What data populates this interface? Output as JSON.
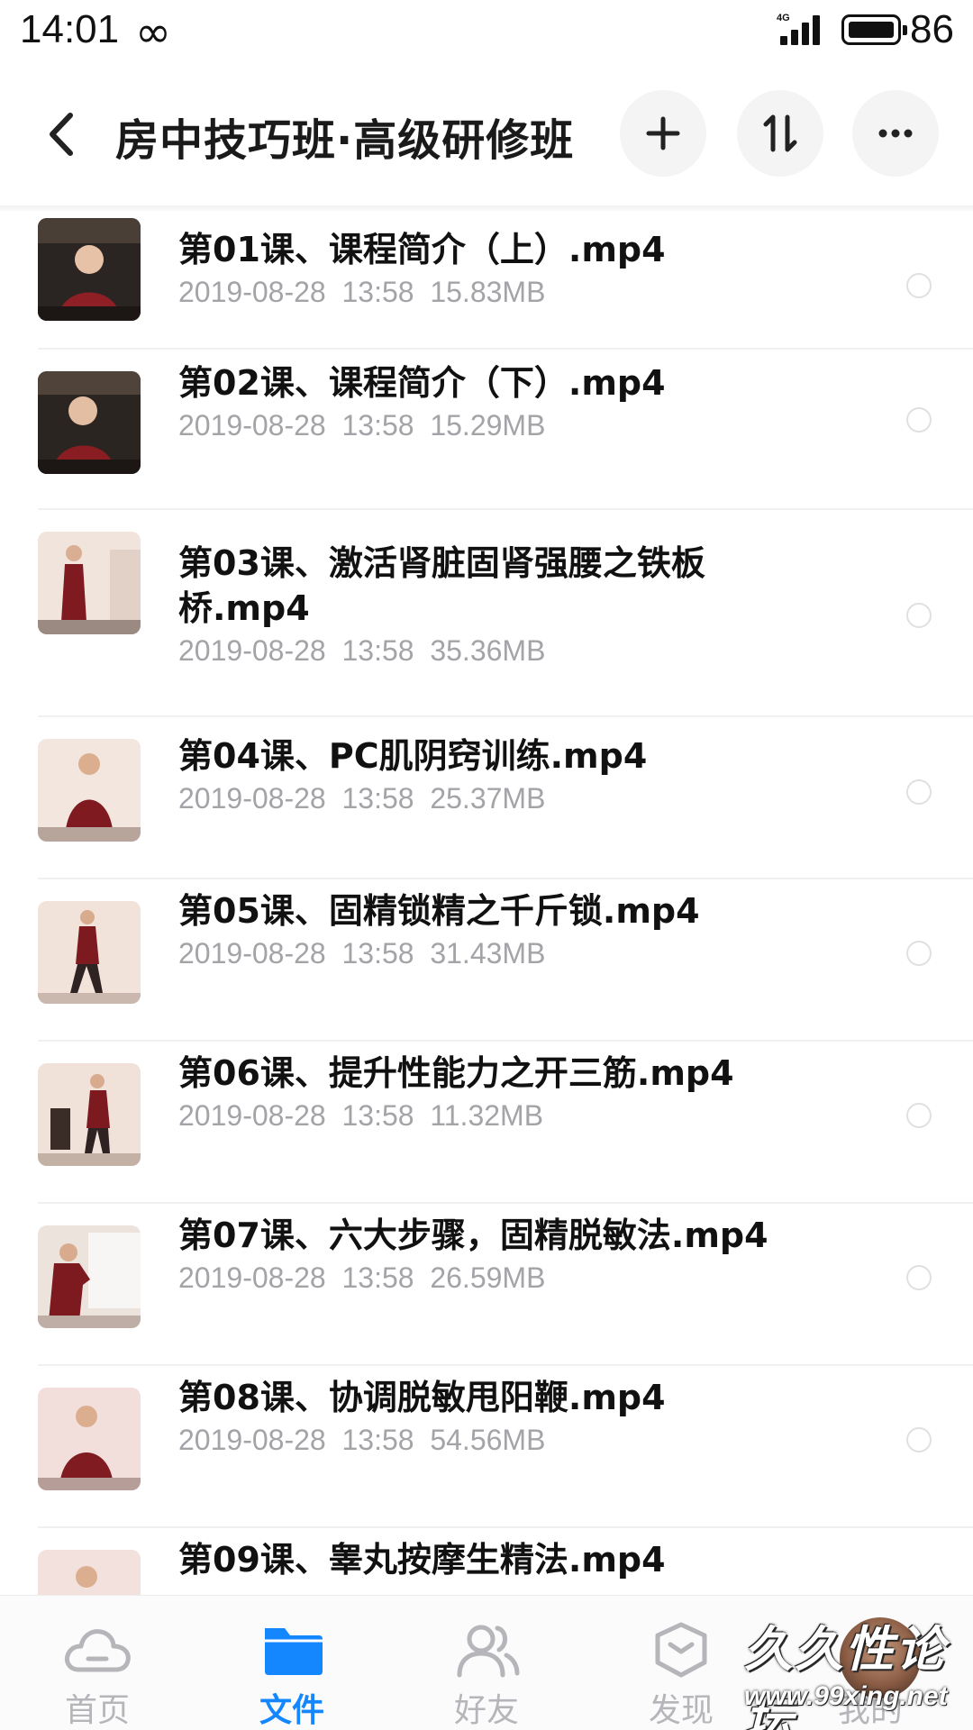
{
  "status_bar": {
    "time": "14:01",
    "network": "4G",
    "battery": "86"
  },
  "header": {
    "title": "房中技巧班·高级研修班"
  },
  "files": [
    {
      "name": "第01课、课程简介（上）.mp4",
      "date": "2019-08-28",
      "time": "13:58",
      "size": "15.83MB"
    },
    {
      "name": "第02课、课程简介（下）.mp4",
      "date": "2019-08-28",
      "time": "13:58",
      "size": "15.29MB"
    },
    {
      "name": "第03课、激活肾脏固肾强腰之铁板桥.mp4",
      "date": "2019-08-28",
      "time": "13:58",
      "size": "35.36MB"
    },
    {
      "name": "第04课、PC肌阴窍训练.mp4",
      "date": "2019-08-28",
      "time": "13:58",
      "size": "25.37MB"
    },
    {
      "name": "第05课、固精锁精之千斤锁.mp4",
      "date": "2019-08-28",
      "time": "13:58",
      "size": "31.43MB"
    },
    {
      "name": "第06课、提升性能力之开三筋.mp4",
      "date": "2019-08-28",
      "time": "13:58",
      "size": "11.32MB"
    },
    {
      "name": "第07课、六大步骤，固精脱敏法.mp4",
      "date": "2019-08-28",
      "time": "13:58",
      "size": "26.59MB"
    },
    {
      "name": "第08课、协调脱敏甩阳鞭.mp4",
      "date": "2019-08-28",
      "time": "13:58",
      "size": "54.56MB"
    },
    {
      "name": "第09课、睾丸按摩生精法.mp4",
      "date": "",
      "time": "",
      "size": ""
    }
  ],
  "tabs": [
    {
      "label": "首页",
      "icon": "cloud-icon",
      "active": false
    },
    {
      "label": "文件",
      "icon": "folder-icon",
      "active": true
    },
    {
      "label": "好友",
      "icon": "friends-icon",
      "active": false
    },
    {
      "label": "发现",
      "icon": "discover-icon",
      "active": false
    },
    {
      "label": "我的",
      "icon": "avatar",
      "active": false
    }
  ],
  "watermark": {
    "text": "久久性论坛",
    "url": "www.99xing.net"
  },
  "colors": {
    "accent": "#1487ff",
    "meta_text": "#a3a3a8",
    "tab_inactive": "#b5b5ba"
  }
}
